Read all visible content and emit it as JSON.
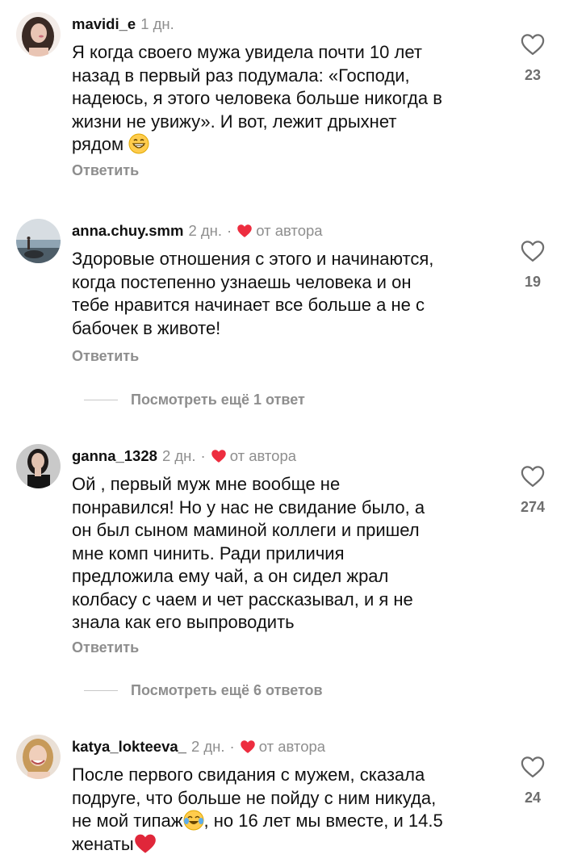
{
  "comments": [
    {
      "username": "mavidi_e",
      "time": "1 дн.",
      "author_liked": false,
      "lines": [
        "Я когда своего мужа увидела почти 10 лет",
        "назад в первый раз подумала: «Господи,",
        "надеюсь, я этого человека больше никогда в",
        "жизни не увижу». И вот, лежит дрыхнет",
        "рядом"
      ],
      "trailing_emoji": "grinning-face-emoji",
      "likes": "23",
      "reply_label": "Ответить"
    },
    {
      "username": "anna.chuy.smm",
      "time": "2 дн.",
      "author_liked": true,
      "dot": "·",
      "author_label": "от автора",
      "lines": [
        "Здоровые отношения с этого и начинаются,",
        "когда постепенно узнаешь человека и он",
        "тебе нравится начинает все больше а не с",
        "бабочек в животе!"
      ],
      "likes": "19",
      "reply_label": "Ответить",
      "view_replies": "Посмотреть ещё 1 ответ"
    },
    {
      "username": "ganna_1328",
      "time": "2 дн.",
      "author_liked": true,
      "dot": "·",
      "author_label": "от автора",
      "lines": [
        "Ой , первый муж мне вообще не",
        "понравился! Но у нас не свидание было, а",
        "он был сыном маминой коллеги и пришел",
        "мне комп чинить. Ради приличия",
        "предложила ему чай, а он сидел жрал",
        "колбасу с чаем и чет рассказывал, и я не",
        "знала как его выпроводить"
      ],
      "likes": "274",
      "reply_label": "Ответить",
      "view_replies": "Посмотреть ещё 6 ответов"
    },
    {
      "username": "katya_lokteeva_",
      "time": "2 дн.",
      "author_liked": true,
      "dot": "·",
      "author_label": "от автора",
      "lines": [
        "После первого свидания с мужем, сказала",
        "подруге, что больше не пойду с ним никуда,"
      ],
      "line3_before": "не мой типаж",
      "line3_emoji": "tears-of-joy-emoji",
      "line3_after": ", но 16 лет мы вместе, и 14.5",
      "line4_text": "женаты",
      "line4_emoji": "red-heart-emoji",
      "likes": "24"
    }
  ],
  "colors": {
    "heart_red": "#ed2d3f",
    "muted": "#8e8e8e",
    "text": "#111111"
  }
}
